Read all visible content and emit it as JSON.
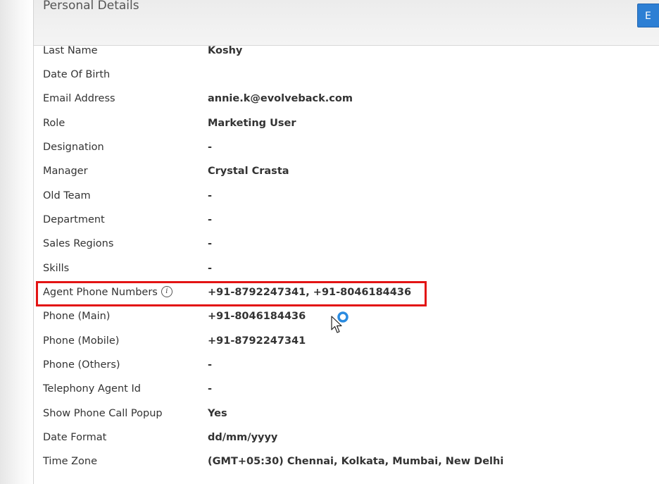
{
  "header": {
    "title": "Personal Details",
    "edit_label": "E"
  },
  "fields": [
    {
      "label": "Last Name",
      "value": "Koshy"
    },
    {
      "label": "Date Of Birth",
      "value": ""
    },
    {
      "label": "Email Address",
      "value": "annie.k@evolveback.com"
    },
    {
      "label": "Role",
      "value": "Marketing User"
    },
    {
      "label": "Designation",
      "value": "-"
    },
    {
      "label": "Manager",
      "value": "Crystal Crasta"
    },
    {
      "label": "Old Team",
      "value": "-"
    },
    {
      "label": "Department",
      "value": "-"
    },
    {
      "label": "Sales Regions",
      "value": "-"
    },
    {
      "label": "Skills",
      "value": "-"
    },
    {
      "label": "Agent Phone Numbers",
      "value": "+91-8792247341, +91-8046184436",
      "icon": "info-icon"
    },
    {
      "label": "Phone (Main)",
      "value": "+91-8046184436"
    },
    {
      "label": "Phone (Mobile)",
      "value": "+91-8792247341"
    },
    {
      "label": "Phone (Others)",
      "value": "-"
    },
    {
      "label": "Telephony Agent Id",
      "value": "-"
    },
    {
      "label": "Show Phone Call Popup",
      "value": "Yes"
    },
    {
      "label": "Date Format",
      "value": "dd/mm/yyyy"
    },
    {
      "label": "Time Zone",
      "value": "(GMT+05:30) Chennai, Kolkata, Mumbai, New Delhi"
    }
  ],
  "colors": {
    "accent_button": "#2d7fd4",
    "highlight": "#e31414",
    "text": "#333333"
  },
  "icons": {
    "info": "info-icon",
    "cursor": "mouse-pointer-icon",
    "busy": "loading-ring-icon"
  }
}
